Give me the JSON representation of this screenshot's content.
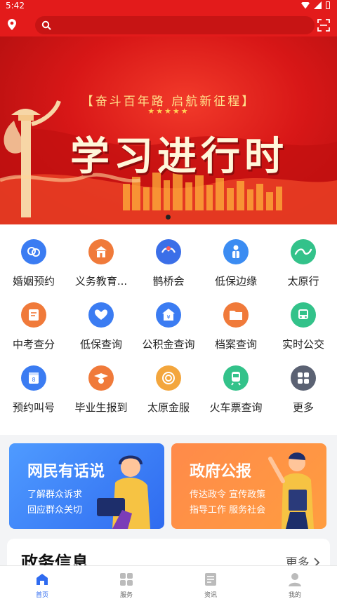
{
  "status": {
    "time": "5:42"
  },
  "search": {
    "placeholder": ""
  },
  "banner": {
    "slogan": "【奋斗百年路 启航新征程】",
    "stars": "★★★★★",
    "title": "学习进行时"
  },
  "services": [
    {
      "label": "婚姻预约",
      "icon": "marriage-icon",
      "color": "#3b7cf2"
    },
    {
      "label": "义务教育...",
      "icon": "school-icon",
      "color": "#f07a3a"
    },
    {
      "label": "鹊桥会",
      "icon": "magpie-bridge-icon",
      "color": "#3b6fe8"
    },
    {
      "label": "低保边缘",
      "icon": "person-icon",
      "color": "#3b8cf2"
    },
    {
      "label": "太原行",
      "icon": "taiyuan-go-icon",
      "color": "#33c28a"
    },
    {
      "label": "中考查分",
      "icon": "exam-icon",
      "color": "#f07a3a"
    },
    {
      "label": "低保查询",
      "icon": "heart-hand-icon",
      "color": "#3b7cf2"
    },
    {
      "label": "公积金查询",
      "icon": "fund-icon",
      "color": "#3b7cf2"
    },
    {
      "label": "档案查询",
      "icon": "folder-icon",
      "color": "#f07a3a"
    },
    {
      "label": "实时公交",
      "icon": "bus-icon",
      "color": "#33c28a"
    },
    {
      "label": "预约叫号",
      "icon": "queue-ticket-icon",
      "color": "#3b7cf2"
    },
    {
      "label": "毕业生报到",
      "icon": "graduate-icon",
      "color": "#f07a3a"
    },
    {
      "label": "太原金服",
      "icon": "coin-icon",
      "color": "#f3a63d"
    },
    {
      "label": "火车票查询",
      "icon": "train-icon",
      "color": "#33c28a"
    },
    {
      "label": "更多",
      "icon": "grid-more-icon",
      "color": "#5b6273"
    }
  ],
  "cards": [
    {
      "title": "网民有话说",
      "line1": "了解群众诉求",
      "line2": "回应群众关切"
    },
    {
      "title": "政府公报",
      "line1": "传达政令  宣传政策",
      "line2": "指导工作  服务社会"
    }
  ],
  "news": {
    "title": "政务信息",
    "more": "更多"
  },
  "tabs": [
    {
      "label": "首页",
      "icon": "home-icon",
      "active": true
    },
    {
      "label": "服务",
      "icon": "services-icon",
      "active": false
    },
    {
      "label": "资讯",
      "icon": "news-icon",
      "active": false
    },
    {
      "label": "我的",
      "icon": "profile-icon",
      "active": false
    }
  ],
  "colors": {
    "brand_red": "#e31b1b",
    "accent_blue": "#2f6bf0"
  }
}
